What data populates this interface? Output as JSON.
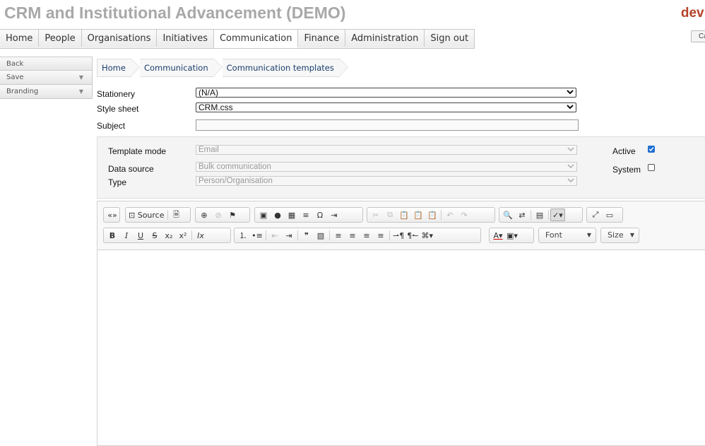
{
  "app": {
    "title": "CRM and Institutional Advancement (DEMO)",
    "brand": "devr",
    "top_button": "Ca"
  },
  "tabs": [
    "Home",
    "People",
    "Organisations",
    "Initiatives",
    "Communication",
    "Finance",
    "Administration",
    "Sign out"
  ],
  "active_tab": "Communication",
  "sidebar": {
    "items": [
      {
        "label": "Back",
        "has_caret": false
      },
      {
        "label": "Save",
        "has_caret": true
      },
      {
        "label": "Branding",
        "has_caret": true
      }
    ]
  },
  "breadcrumb": [
    "Home",
    "Communication",
    "Communication templates"
  ],
  "form": {
    "stationery": {
      "label": "Stationery",
      "value": "(N/A)"
    },
    "style_sheet": {
      "label": "Style sheet",
      "value": "CRM.css"
    },
    "subject": {
      "label": "Subject",
      "value": ""
    }
  },
  "settings": {
    "template_mode": {
      "label": "Template mode",
      "value": "Email"
    },
    "data_source": {
      "label": "Data source",
      "value": "Bulk communication"
    },
    "type": {
      "label": "Type",
      "value": "Person/Organisation"
    },
    "active": {
      "label": "Active",
      "checked": true
    },
    "system": {
      "label": "System",
      "checked": false
    }
  },
  "editor": {
    "source_label": "Source",
    "font_label": "Font",
    "size_label": "Size",
    "body": ""
  },
  "colors": {
    "accent_check": "#1f6fd1",
    "brand": "#b4432a",
    "crumb_text": "#1a3d6b"
  }
}
